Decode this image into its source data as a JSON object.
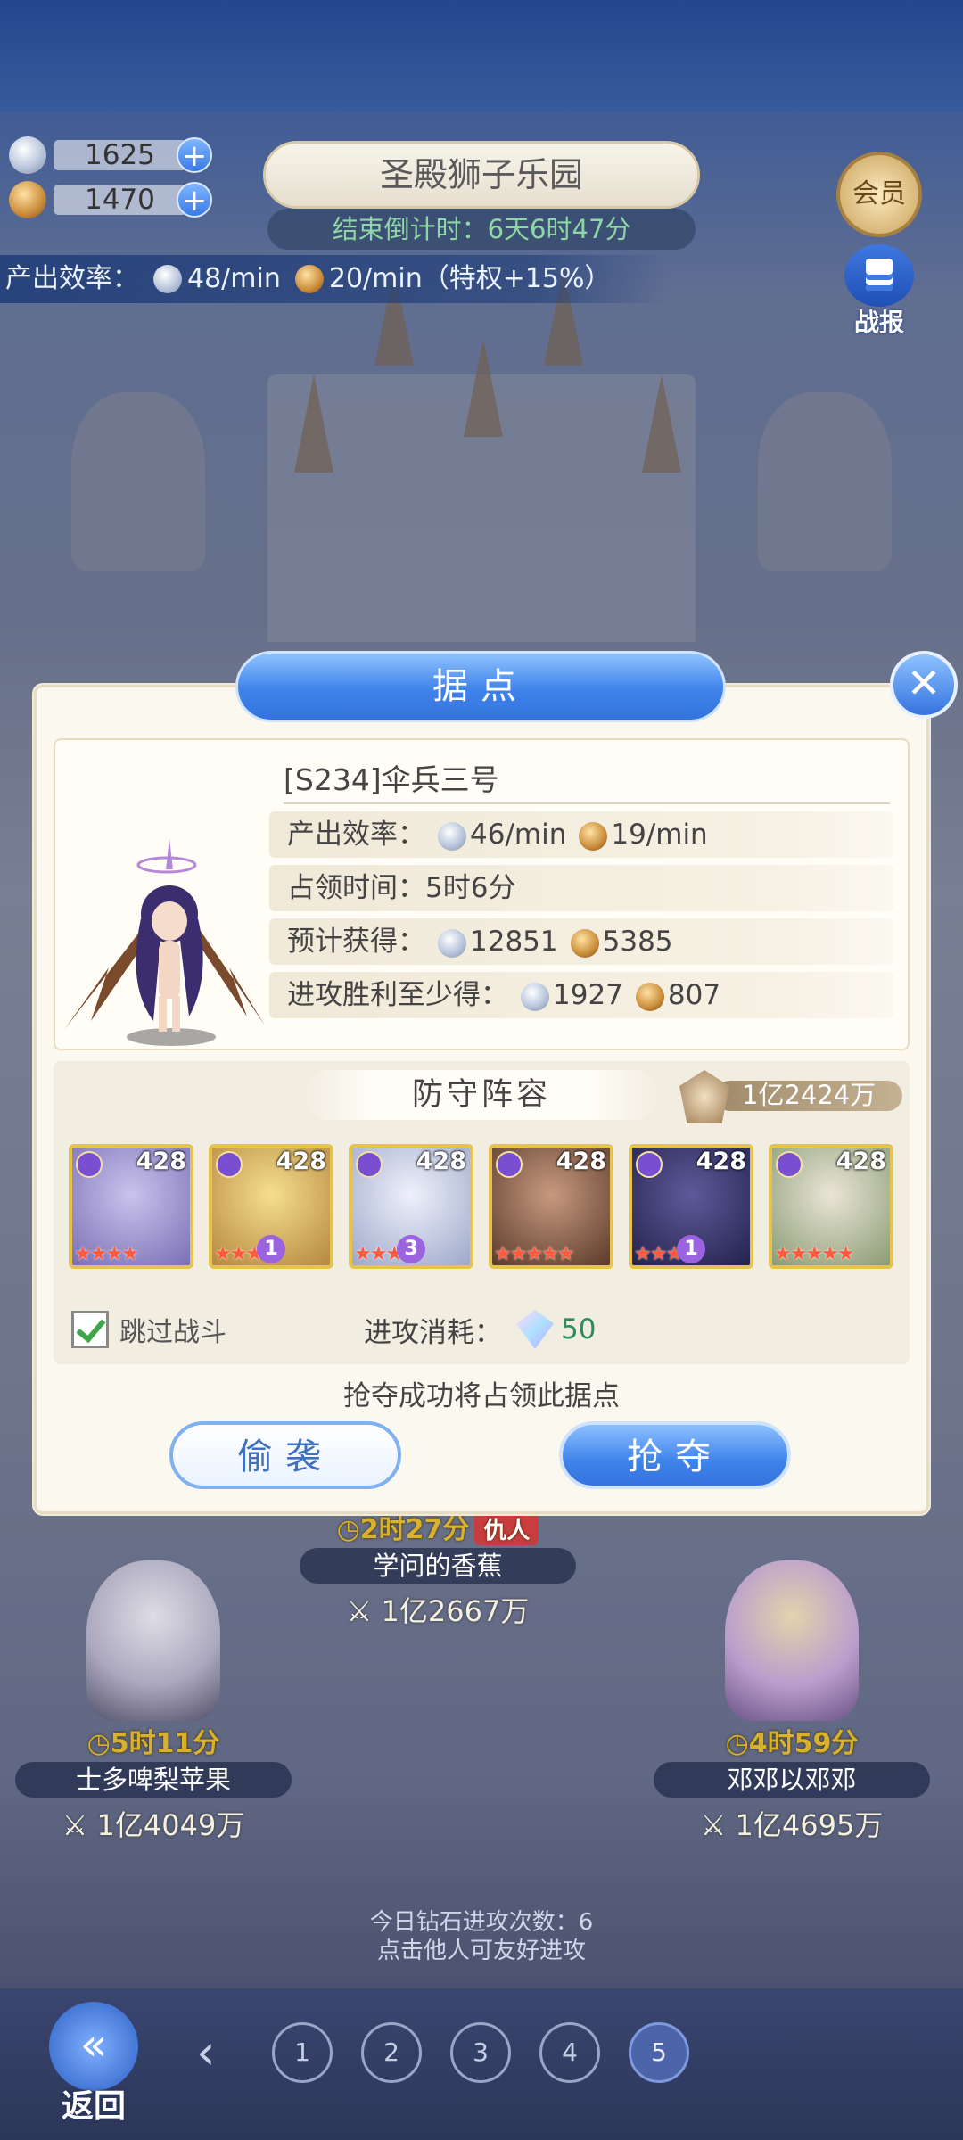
{
  "hud": {
    "crystal_amount": "1625",
    "gold_amount": "1470",
    "plus": "+",
    "map_title": "圣殿狮子乐园",
    "countdown_label": "结束倒计时：",
    "countdown_value": "6天6时47分",
    "output_label": "产出效率：",
    "output_crystal": "48/min",
    "output_gold": "20/min（特权+15%）",
    "vip_label": "会员",
    "report_label": "战报"
  },
  "background_players": [
    {
      "timer": "2时27分",
      "tag": "仇人",
      "name": "学问的香蕉",
      "power": "1亿2667万"
    },
    {
      "timer": "5时11分",
      "name": "士多啤梨苹果",
      "power": "1亿4049万"
    },
    {
      "timer": "4时59分",
      "name": "邓邓以邓邓",
      "power": "1亿4695万"
    }
  ],
  "diamond_info": {
    "line1": "今日钻石进攻次数：6",
    "line2": "点击他人可友好进攻"
  },
  "bottom": {
    "back_label": "返回",
    "prev": "‹",
    "pages": [
      "1",
      "2",
      "3",
      "4",
      "5"
    ],
    "active_page": "5"
  },
  "modal": {
    "title": "据点",
    "close": "✕",
    "player_name": "[S234]伞兵三号",
    "output_label": "产出效率：",
    "output_crystal": "46/min",
    "output_gold": "19/min",
    "occupy_label": "占领时间：",
    "occupy_value": "5时6分",
    "expected_label": "预计获得：",
    "expected_crystal": "12851",
    "expected_gold": "5385",
    "win_label": "进攻胜利至少得：",
    "win_crystal": "1927",
    "win_gold": "807",
    "defense_title": "防守阵容",
    "defense_power": "1亿2424万",
    "heroes": [
      {
        "level": "428",
        "stars": "★★★★",
        "badge": "",
        "palette": [
          "#c9c3ec",
          "#7b6fb5"
        ]
      },
      {
        "level": "428",
        "stars": "★★★★",
        "badge": "1",
        "palette": [
          "#f6de8f",
          "#b4883e"
        ]
      },
      {
        "level": "428",
        "stars": "★★★★",
        "badge": "3",
        "palette": [
          "#eef1fb",
          "#9ea8c9"
        ]
      },
      {
        "level": "428",
        "stars": "★★★★★",
        "badge": "",
        "palette": [
          "#c79a7f",
          "#5b3a2a"
        ]
      },
      {
        "level": "428",
        "stars": "★★★★",
        "badge": "1",
        "palette": [
          "#5e5a9a",
          "#24224d"
        ]
      },
      {
        "level": "428",
        "stars": "★★★★★",
        "badge": "",
        "palette": [
          "#eae5d6",
          "#8a9b74"
        ]
      }
    ],
    "skip_battle": "跳过战斗",
    "attack_cost_label": "进攻消耗：",
    "attack_cost_value": "50",
    "capture_note": "抢夺成功将占领此据点",
    "sneak_label": "偷袭",
    "rob_label": "抢夺"
  },
  "colors": {
    "accent_blue": "#3f83ea",
    "panel_cream": "#fbf8ef",
    "cost_green": "#2c8c5a",
    "enemy_red": "#c83d3d"
  }
}
